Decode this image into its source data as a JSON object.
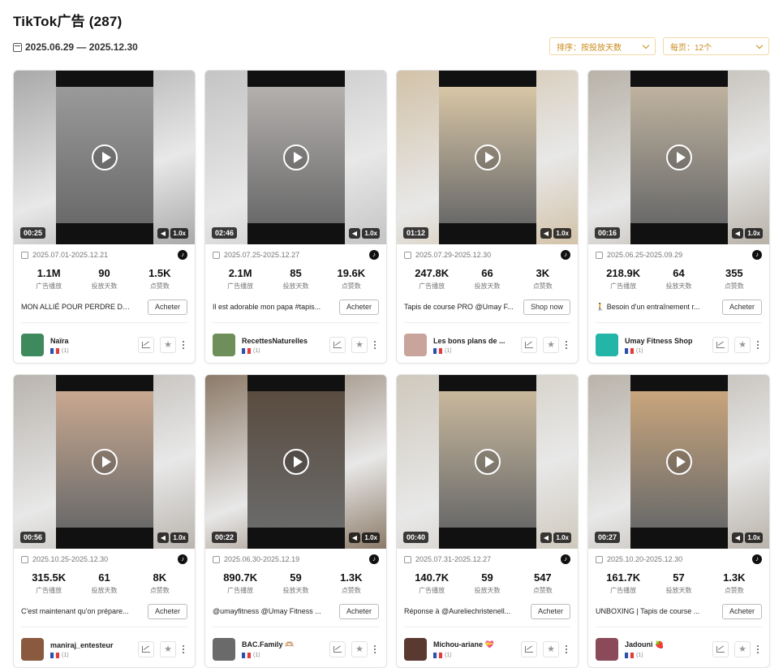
{
  "header": {
    "title": "TikTok广告 (287)",
    "date_range": "2025.06.29 — 2025.12.30",
    "sort_label": "排序：按投放天数",
    "page_size_label": "每页：12个"
  },
  "stat_labels": {
    "plays": "广告播放",
    "days": "投放天数",
    "likes": "点赞数"
  },
  "cards": [
    {
      "duration": "00:25",
      "speed": "1.0x",
      "period": "2025.07.01-2025.12.21",
      "plays": "1.1M",
      "days": "90",
      "likes": "1.5K",
      "text": "MON ALLIÉ POUR PERDRE DU ...",
      "cta": "Acheter",
      "advertiser": "Naïra",
      "country_count": "(1)",
      "bg": "#a9a9a9",
      "scene": "#9a9a9a",
      "avatar": "#3f8a5c"
    },
    {
      "duration": "02:46",
      "speed": "1.0x",
      "period": "2025.07.25-2025.12.27",
      "plays": "2.1M",
      "days": "85",
      "likes": "19.6K",
      "text": "Il est adorable mon papa #tapis...",
      "cta": "Acheter",
      "advertiser": "RecettesNaturelles",
      "country_count": "(1)",
      "bg": "#c4c4c4",
      "scene": "#b4b0ae",
      "avatar": "#6f8f5a"
    },
    {
      "duration": "01:12",
      "speed": "1.0x",
      "period": "2025.07.29-2025.12.30",
      "plays": "247.8K",
      "days": "66",
      "likes": "3K",
      "text": "Tapis de course PRO @Umay F...",
      "cta": "Shop now",
      "advertiser": "Les bons plans de ...",
      "country_count": "(1)",
      "bg": "#d2c2a8",
      "scene": "#d8c6a6",
      "avatar": "#c9a49b"
    },
    {
      "duration": "00:16",
      "speed": "1.0x",
      "period": "2025.06.25-2025.09.29",
      "plays": "218.9K",
      "days": "64",
      "likes": "355",
      "text": "🚶 Besoin d'un entraînement r...",
      "cta": "Acheter",
      "advertiser": "Umay Fitness Shop",
      "country_count": "(1)",
      "bg": "#b8b2a8",
      "scene": "#bfb39f",
      "avatar": "#22b5a8"
    },
    {
      "duration": "00:56",
      "speed": "1.0x",
      "period": "2025.10.25-2025.12.30",
      "plays": "315.5K",
      "days": "61",
      "likes": "8K",
      "text": "C'est maintenant qu'on prépare...",
      "cta": "Acheter",
      "advertiser": "maniraj_entesteur",
      "country_count": "(1)",
      "bg": "#b9b4ae",
      "scene": "#c9a890",
      "avatar": "#8a5a3f"
    },
    {
      "duration": "00:22",
      "speed": "1.0x",
      "period": "2025.06.30-2025.12.19",
      "plays": "890.7K",
      "days": "59",
      "likes": "1.3K",
      "text": "@umayfitness @Umay Fitness ...",
      "cta": "Acheter",
      "advertiser": "BAC.Family 🫶🏼",
      "country_count": "(1)",
      "bg": "#8c7a68",
      "scene": "#5a4c40",
      "avatar": "#6a6a6a"
    },
    {
      "duration": "00:40",
      "speed": "1.0x",
      "period": "2025.07.31-2025.12.27",
      "plays": "140.7K",
      "days": "59",
      "likes": "547",
      "text": "Réponse à @Aureliechristenell...",
      "cta": "Acheter",
      "advertiser": "Michou-ariane 💝",
      "country_count": "(1)",
      "bg": "#cfc9bd",
      "scene": "#c8b89c",
      "avatar": "#5a3a30"
    },
    {
      "duration": "00:27",
      "speed": "1.0x",
      "period": "2025.10.20-2025.12.30",
      "plays": "161.7K",
      "days": "57",
      "likes": "1.3K",
      "text": "UNBOXING | Tapis de course ...",
      "cta": "Acheter",
      "advertiser": "Jadouni 🍓",
      "country_count": "(1)",
      "bg": "#b9b3aa",
      "scene": "#c9a57c",
      "avatar": "#8a4a5a"
    }
  ]
}
